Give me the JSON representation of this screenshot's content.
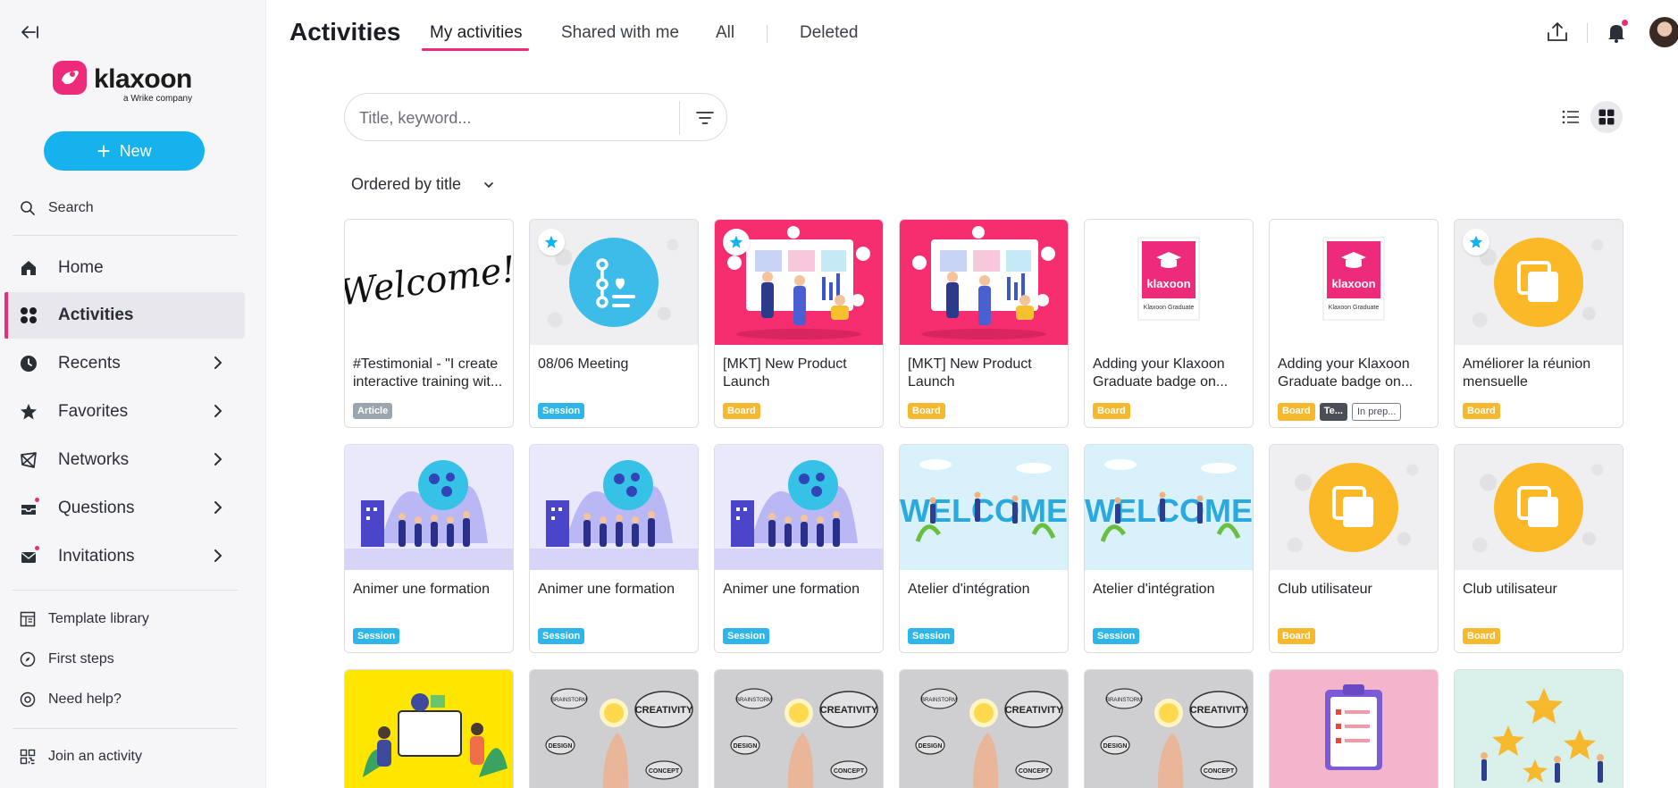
{
  "sidebar": {
    "logo_text": "klaxoon",
    "logo_sub": "a Wrike company",
    "new_label": "New",
    "search_label": "Search",
    "nav": [
      {
        "label": "Home",
        "icon": "home-icon"
      },
      {
        "label": "Activities",
        "icon": "grid-icon",
        "active": true
      },
      {
        "label": "Recents",
        "icon": "clock-icon"
      },
      {
        "label": "Favorites",
        "icon": "star-icon"
      },
      {
        "label": "Networks",
        "icon": "network-icon"
      },
      {
        "label": "Questions",
        "icon": "inbox-icon"
      },
      {
        "label": "Invitations",
        "icon": "mail-icon"
      }
    ],
    "utilities": [
      {
        "label": "Template library",
        "icon": "template-icon"
      },
      {
        "label": "First steps",
        "icon": "compass-icon"
      },
      {
        "label": "Need help?",
        "icon": "help-icon"
      }
    ],
    "join_label": "Join an activity"
  },
  "header": {
    "title": "Activities",
    "tabs": [
      "My activities",
      "Shared with me",
      "All",
      "Deleted"
    ],
    "active_tab": "My activities"
  },
  "toolbar": {
    "search_placeholder": "Title, keyword...",
    "sort_label": "Ordered by title"
  },
  "cards": [
    {
      "title": "#Testimonial - \"I create interactive training wit...",
      "tags": [
        "Article"
      ],
      "thumb": "welcome-handwriting"
    },
    {
      "title": "08/06 Meeting",
      "tags": [
        "Session"
      ],
      "thumb": "session-icon-blue",
      "starred": true
    },
    {
      "title": "[MKT] New Product Launch",
      "tags": [
        "Board"
      ],
      "thumb": "marketing-illustration",
      "starred": true
    },
    {
      "title": "[MKT] New Product Launch",
      "tags": [
        "Board"
      ],
      "thumb": "marketing-illustration"
    },
    {
      "title": "Adding your Klaxoon Graduate badge on...",
      "tags": [
        "Board"
      ],
      "thumb": "graduate-badge"
    },
    {
      "title": "Adding your Klaxoon Graduate badge on...",
      "tags": [
        "Board",
        "Te...",
        "In prep..."
      ],
      "thumb": "graduate-badge"
    },
    {
      "title": "Améliorer la réunion mensuelle",
      "tags": [
        "Board"
      ],
      "thumb": "board-icon-amber",
      "starred": true
    },
    {
      "title": "Animer une formation",
      "tags": [
        "Session"
      ],
      "thumb": "training-illustration"
    },
    {
      "title": "Animer une formation",
      "tags": [
        "Session"
      ],
      "thumb": "training-illustration"
    },
    {
      "title": "Animer une formation",
      "tags": [
        "Session"
      ],
      "thumb": "training-illustration"
    },
    {
      "title": "Atelier d'intégration",
      "tags": [
        "Session"
      ],
      "thumb": "welcome-illustration"
    },
    {
      "title": "Atelier d'intégration",
      "tags": [
        "Session"
      ],
      "thumb": "welcome-illustration"
    },
    {
      "title": "Club utilisateur",
      "tags": [
        "Board"
      ],
      "thumb": "board-icon-amber"
    },
    {
      "title": "Club utilisateur",
      "tags": [
        "Board"
      ],
      "thumb": "board-icon-amber"
    }
  ],
  "partial_row": [
    {
      "thumb": "team-yellow"
    },
    {
      "thumb": "creativity-bulb"
    },
    {
      "thumb": "creativity-bulb"
    },
    {
      "thumb": "creativity-bulb"
    },
    {
      "thumb": "creativity-bulb"
    },
    {
      "thumb": "clipboard-checklist"
    },
    {
      "thumb": "stars-rating"
    }
  ],
  "thumb_text": {
    "welcome": "Welcome!",
    "welcome_upper": "WELCOME",
    "badge_brand": "klaxoon",
    "badge_caption": "Klaxoon Graduate",
    "creativity": "CREATIVITY",
    "design": "DESIGN",
    "concept": "CONCEPT",
    "brainstorm": "BRAINSTORM"
  },
  "colors": {
    "brand_pink": "#ee2a7b",
    "accent_blue": "#15b2ee",
    "board_tag": "#f6b82c",
    "session_tag": "#2eb6ea",
    "article_tag": "#9aa5ad"
  }
}
